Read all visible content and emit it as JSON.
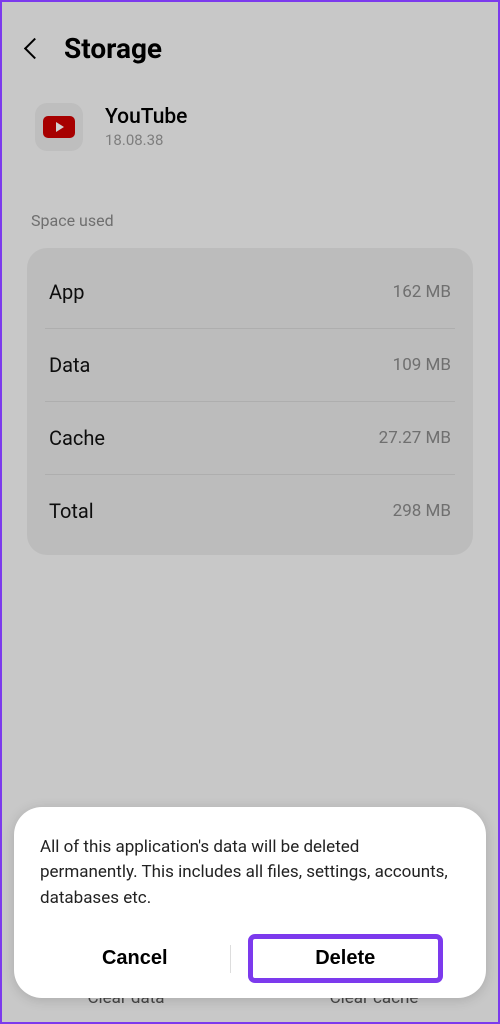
{
  "header": {
    "title": "Storage"
  },
  "app": {
    "name": "YouTube",
    "version": "18.08.38"
  },
  "section_label": "Space used",
  "rows": [
    {
      "label": "App",
      "value": "162 MB"
    },
    {
      "label": "Data",
      "value": "109 MB"
    },
    {
      "label": "Cache",
      "value": "27.27 MB"
    },
    {
      "label": "Total",
      "value": "298 MB"
    }
  ],
  "bottom": {
    "clear_data": "Clear data",
    "clear_cache": "Clear cache"
  },
  "dialog": {
    "message": "All of this application's data will be deleted permanently. This includes all files, settings, accounts, databases etc.",
    "cancel": "Cancel",
    "delete": "Delete"
  }
}
